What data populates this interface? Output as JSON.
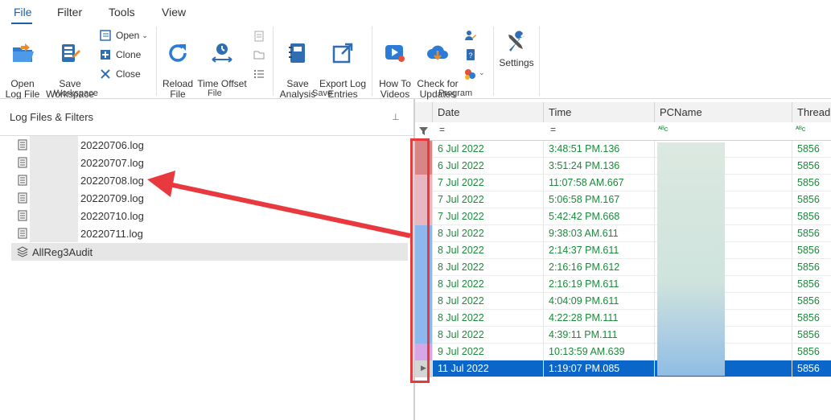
{
  "menu": [
    "File",
    "Filter",
    "Tools",
    "View"
  ],
  "ribbon": {
    "open_log_file": "Open\nLog File",
    "save_workspace": "Save\nWorkspace",
    "open": "Open",
    "clone": "Clone",
    "close": "Close",
    "workspace_group": "Workspace",
    "reload_file": "Reload\nFile",
    "time_offset": "Time Offset",
    "file_group": "File",
    "save_analysis": "Save\nAnalysis",
    "export_log_entries": "Export Log\nEntries",
    "save_group": "Save",
    "how_to_videos": "How To\nVideos",
    "check_for_updates": "Check for\nUpdates",
    "program_group": "Program",
    "settings": "Settings"
  },
  "left_panel": {
    "title": "Log Files & Filters",
    "files": [
      "20220706.log",
      "20220707.log",
      "20220708.log",
      "20220709.log",
      "20220710.log",
      "20220711.log"
    ],
    "filter_item": "AllReg3Audit"
  },
  "grid": {
    "columns": [
      "Date",
      "Time",
      "PCName",
      "Thread"
    ],
    "filter_glyphs": [
      "=",
      "=",
      "ᴬᴮc",
      "ᴬᴮc"
    ],
    "rows": [
      {
        "date": "6 Jul 2022",
        "time": "3:48:51 PM.136",
        "thread": "5856"
      },
      {
        "date": "6 Jul 2022",
        "time": "3:51:24 PM.136",
        "thread": "5856"
      },
      {
        "date": "7 Jul 2022",
        "time": "11:07:58 AM.667",
        "thread": "5856"
      },
      {
        "date": "7 Jul 2022",
        "time": "5:06:58 PM.167",
        "thread": "5856"
      },
      {
        "date": "7 Jul 2022",
        "time": "5:42:42 PM.668",
        "thread": "5856"
      },
      {
        "date": "8 Jul 2022",
        "time": "9:38:03 AM.611",
        "thread": "5856"
      },
      {
        "date": "8 Jul 2022",
        "time": "2:14:37 PM.611",
        "thread": "5856"
      },
      {
        "date": "8 Jul 2022",
        "time": "2:16:16 PM.612",
        "thread": "5856"
      },
      {
        "date": "8 Jul 2022",
        "time": "2:16:19 PM.611",
        "thread": "5856"
      },
      {
        "date": "8 Jul 2022",
        "time": "4:04:09 PM.611",
        "thread": "5856"
      },
      {
        "date": "8 Jul 2022",
        "time": "4:22:28 PM.111",
        "thread": "5856"
      },
      {
        "date": "8 Jul 2022",
        "time": "4:39:11 PM.111",
        "thread": "5856"
      },
      {
        "date": "9 Jul 2022",
        "time": "10:13:59 AM.639",
        "thread": "5856"
      },
      {
        "date": "11 Jul 2022",
        "time": "1:19:07 PM.085",
        "thread": "5856",
        "selected": true
      }
    ]
  },
  "colors": {
    "accent": "#1f5fa8",
    "row_text": "#1a8a3a",
    "selection": "#0a66c8",
    "annotation": "#e8393f",
    "stripe_0706": "#d98585",
    "stripe_0707": "#e9b7c2",
    "stripe_0708": "#8db8ee",
    "stripe_0709": "#d7a6e6",
    "stripe_0711": "#aaaaaa"
  }
}
